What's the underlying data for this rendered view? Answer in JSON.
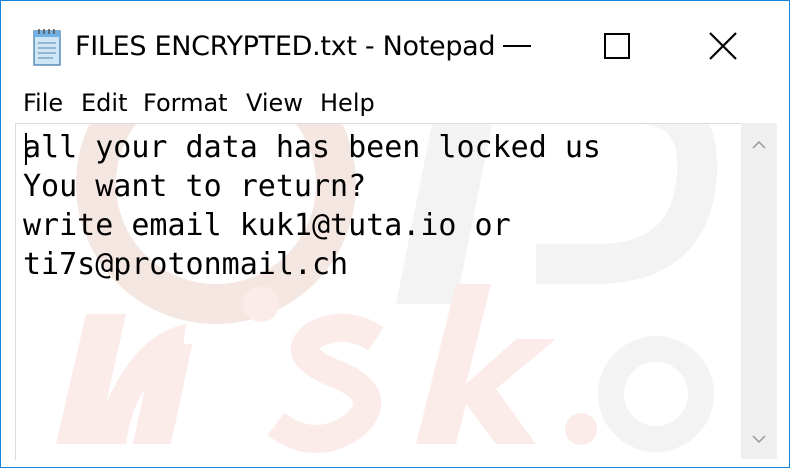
{
  "window": {
    "title": "FILES ENCRYPTED.txt - Notepad",
    "border_color": "#1883d7",
    "controls": {
      "minimize_icon": "minimize-icon",
      "maximize_icon": "maximize-icon",
      "close_icon": "close-icon"
    }
  },
  "menubar": {
    "items": [
      {
        "label": "File"
      },
      {
        "label": "Edit"
      },
      {
        "label": "Format"
      },
      {
        "label": "View"
      },
      {
        "label": "Help"
      }
    ]
  },
  "document": {
    "lines": [
      "all your data has been locked us",
      "You want to return?",
      "write email kuk1@tuta.io or",
      "ti7s@protonmail.ch"
    ]
  },
  "scrollbar": {
    "up_icon": "chevron-up-icon",
    "down_icon": "chevron-down-icon"
  }
}
